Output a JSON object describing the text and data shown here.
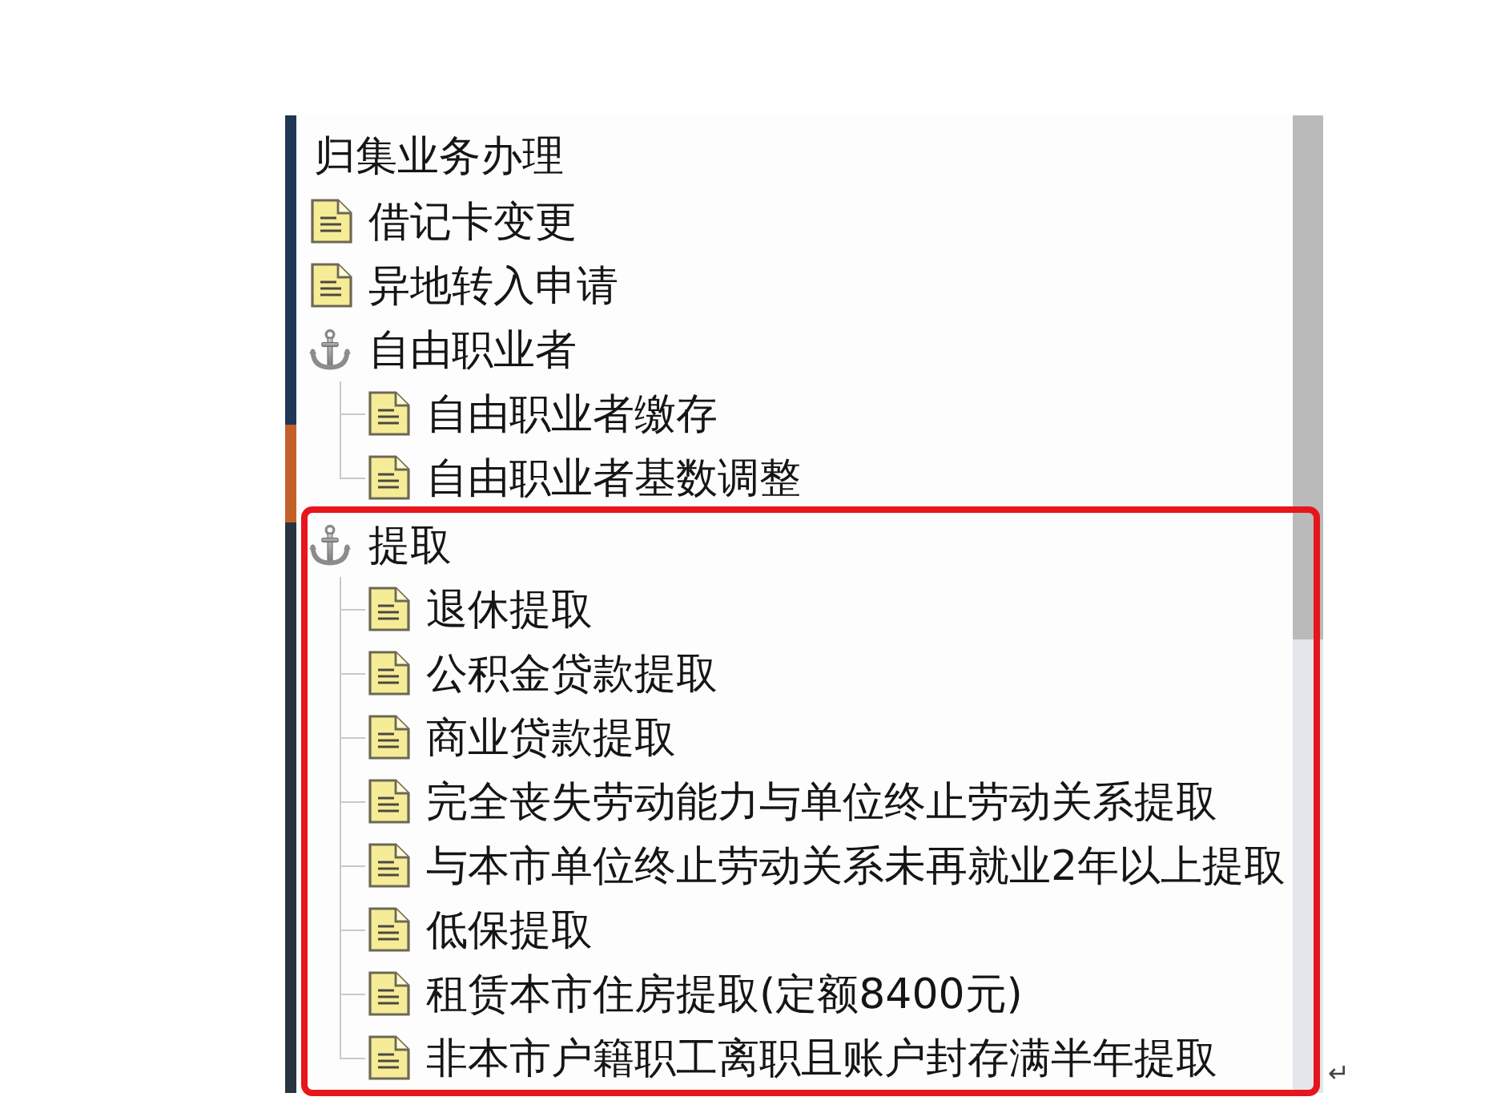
{
  "tree": {
    "title": "归集业务办理",
    "items": [
      {
        "kind": "document",
        "label": "借记卡变更",
        "highlighted": false
      },
      {
        "kind": "document",
        "label": "异地转入申请",
        "highlighted": false
      },
      {
        "kind": "group",
        "label": "自由职业者",
        "highlighted": false,
        "children": [
          {
            "kind": "document",
            "label": "自由职业者缴存"
          },
          {
            "kind": "document",
            "label": "自由职业者基数调整"
          }
        ]
      },
      {
        "kind": "group",
        "label": "提取",
        "highlighted": true,
        "children": [
          {
            "kind": "document",
            "label": "退休提取"
          },
          {
            "kind": "document",
            "label": "公积金贷款提取"
          },
          {
            "kind": "document",
            "label": "商业贷款提取"
          },
          {
            "kind": "document",
            "label": "完全丧失劳动能力与单位终止劳动关系提取"
          },
          {
            "kind": "document",
            "label": "与本市单位终止劳动关系未再就业2年以上提取"
          },
          {
            "kind": "document",
            "label": "低保提取"
          },
          {
            "kind": "document",
            "label": "租赁本市住房提取(定额8400元)"
          },
          {
            "kind": "document",
            "label": "非本市户籍职工离职且账户封存满半年提取"
          }
        ]
      }
    ]
  },
  "paragraph_mark": "↵"
}
